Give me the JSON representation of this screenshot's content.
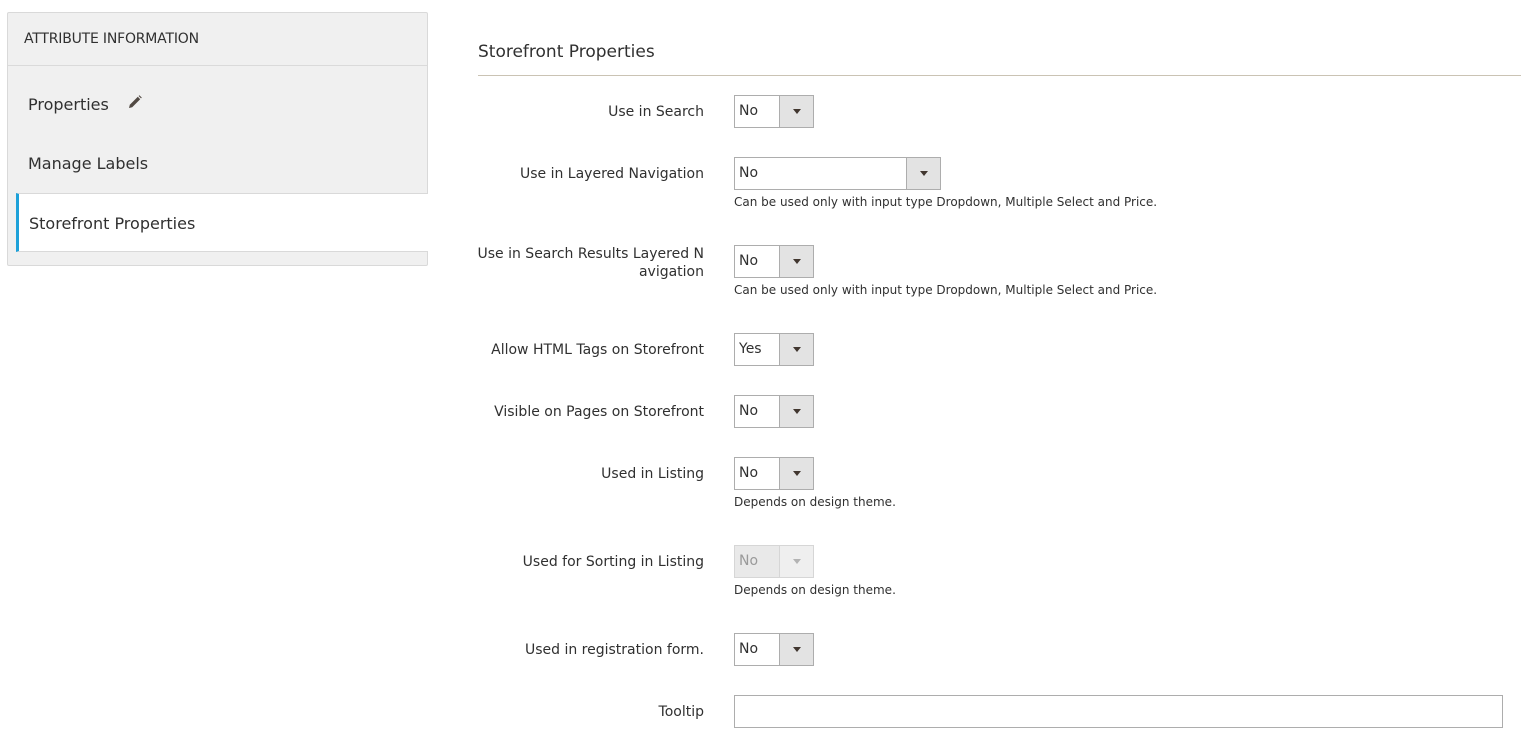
{
  "sidebar": {
    "header": "ATTRIBUTE INFORMATION",
    "items": [
      {
        "label": "Properties",
        "icon": "pencil-icon"
      },
      {
        "label": "Manage Labels"
      },
      {
        "label": "Storefront Properties",
        "active": true
      }
    ]
  },
  "colors": {
    "accent": "#1da1d9",
    "sidebar_bg": "#f0f0f0",
    "rule": "#cac3b4"
  },
  "main": {
    "title": "Storefront Properties",
    "fields": [
      {
        "label": "Use in Search",
        "value": "No"
      },
      {
        "label": "Use in Layered Navigation",
        "value": "No",
        "note": "Can be used only with input type Dropdown, Multiple Select and Price."
      },
      {
        "label": "Use in Search Results Layered N avigation",
        "label_line1": "Use in Search Results Layered N",
        "label_line2": "avigation",
        "value": "No",
        "note": "Can be used only with input type Dropdown, Multiple Select and Price."
      },
      {
        "label": "Allow HTML Tags on Storefront",
        "value": "Yes"
      },
      {
        "label": "Visible on Pages on Storefront",
        "value": "No"
      },
      {
        "label": "Used in Listing",
        "value": "No",
        "note": "Depends on design theme."
      },
      {
        "label": "Used for Sorting in Listing",
        "value": "No",
        "disabled": true,
        "note": "Depends on design theme."
      },
      {
        "label": "Used in registration form.",
        "value": "No"
      },
      {
        "label": "Tooltip",
        "value": ""
      }
    ]
  }
}
